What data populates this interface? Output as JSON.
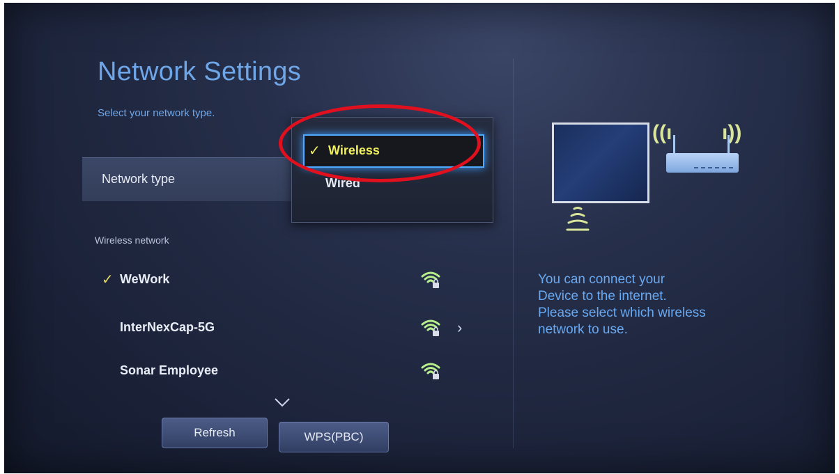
{
  "screen": {
    "title": "Network Settings",
    "subtitle": "Select your network type."
  },
  "network_type": {
    "label": "Network type",
    "options": [
      {
        "label": "Wireless",
        "selected": true
      },
      {
        "label": "Wired",
        "selected": false
      }
    ]
  },
  "wireless_section": {
    "label": "Wireless network",
    "networks": [
      {
        "name": "WeWork",
        "connected": true,
        "icon": "wifi-lock-icon"
      },
      {
        "name": "InterNexCap-5G",
        "connected": false,
        "icon": "wifi-lock-icon",
        "has_more": true
      },
      {
        "name": "Sonar Employee",
        "connected": false,
        "icon": "wifi-lock-icon"
      }
    ]
  },
  "buttons": {
    "refresh": "Refresh",
    "wps": "WPS(PBC)"
  },
  "help": {
    "lines": [
      "You can connect your",
      "Device to the internet.",
      "Please select which wireless",
      "network to use."
    ]
  },
  "colors": {
    "accent_blue": "#6fa6e8",
    "selection_yellow": "#f1f060",
    "focus_glow": "#4fa9ff",
    "annotation_red": "#e1101e"
  }
}
